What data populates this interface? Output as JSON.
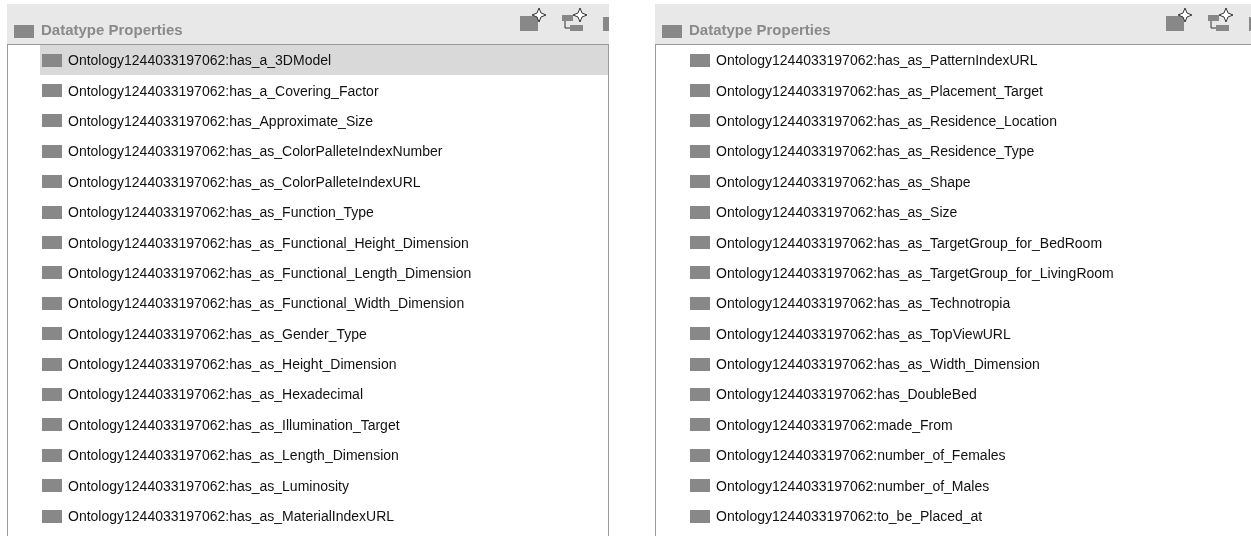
{
  "panels": [
    {
      "title": "Datatype Properties",
      "rows": [
        {
          "label": "Ontology1244033197062:has_a_3DModel",
          "selected": true
        },
        {
          "label": "Ontology1244033197062:has_a_Covering_Factor",
          "selected": false
        },
        {
          "label": "Ontology1244033197062:has_Approximate_Size",
          "selected": false
        },
        {
          "label": "Ontology1244033197062:has_as_ColorPalleteIndexNumber",
          "selected": false
        },
        {
          "label": "Ontology1244033197062:has_as_ColorPalleteIndexURL",
          "selected": false
        },
        {
          "label": "Ontology1244033197062:has_as_Function_Type",
          "selected": false
        },
        {
          "label": "Ontology1244033197062:has_as_Functional_Height_Dimension",
          "selected": false
        },
        {
          "label": "Ontology1244033197062:has_as_Functional_Length_Dimension",
          "selected": false
        },
        {
          "label": "Ontology1244033197062:has_as_Functional_Width_Dimension",
          "selected": false
        },
        {
          "label": "Ontology1244033197062:has_as_Gender_Type",
          "selected": false
        },
        {
          "label": "Ontology1244033197062:has_as_Height_Dimension",
          "selected": false
        },
        {
          "label": "Ontology1244033197062:has_as_Hexadecimal",
          "selected": false
        },
        {
          "label": "Ontology1244033197062:has_as_Illumination_Target",
          "selected": false
        },
        {
          "label": "Ontology1244033197062:has_as_Length_Dimension",
          "selected": false
        },
        {
          "label": "Ontology1244033197062:has_as_Luminosity",
          "selected": false
        },
        {
          "label": "Ontology1244033197062:has_as_MaterialIndexURL",
          "selected": false
        }
      ]
    },
    {
      "title": "Datatype Properties",
      "rows": [
        {
          "label": "Ontology1244033197062:has_as_PatternIndexURL",
          "selected": false
        },
        {
          "label": "Ontology1244033197062:has_as_Placement_Target",
          "selected": false
        },
        {
          "label": "Ontology1244033197062:has_as_Residence_Location",
          "selected": false
        },
        {
          "label": "Ontology1244033197062:has_as_Residence_Type",
          "selected": false
        },
        {
          "label": "Ontology1244033197062:has_as_Shape",
          "selected": false
        },
        {
          "label": "Ontology1244033197062:has_as_Size",
          "selected": false
        },
        {
          "label": "Ontology1244033197062:has_as_TargetGroup_for_BedRoom",
          "selected": false
        },
        {
          "label": "Ontology1244033197062:has_as_TargetGroup_for_LivingRoom",
          "selected": false
        },
        {
          "label": "Ontology1244033197062:has_as_Technotropia",
          "selected": false
        },
        {
          "label": "Ontology1244033197062:has_as_TopViewURL",
          "selected": false
        },
        {
          "label": "Ontology1244033197062:has_as_Width_Dimension",
          "selected": false
        },
        {
          "label": "Ontology1244033197062:has_DoubleBed",
          "selected": false
        },
        {
          "label": "Ontology1244033197062:made_From",
          "selected": false
        },
        {
          "label": "Ontology1244033197062:number_of_Females",
          "selected": false
        },
        {
          "label": "Ontology1244033197062:number_of_Males",
          "selected": false
        },
        {
          "label": "Ontology1244033197062:to_be_Placed_at",
          "selected": false
        }
      ]
    }
  ]
}
